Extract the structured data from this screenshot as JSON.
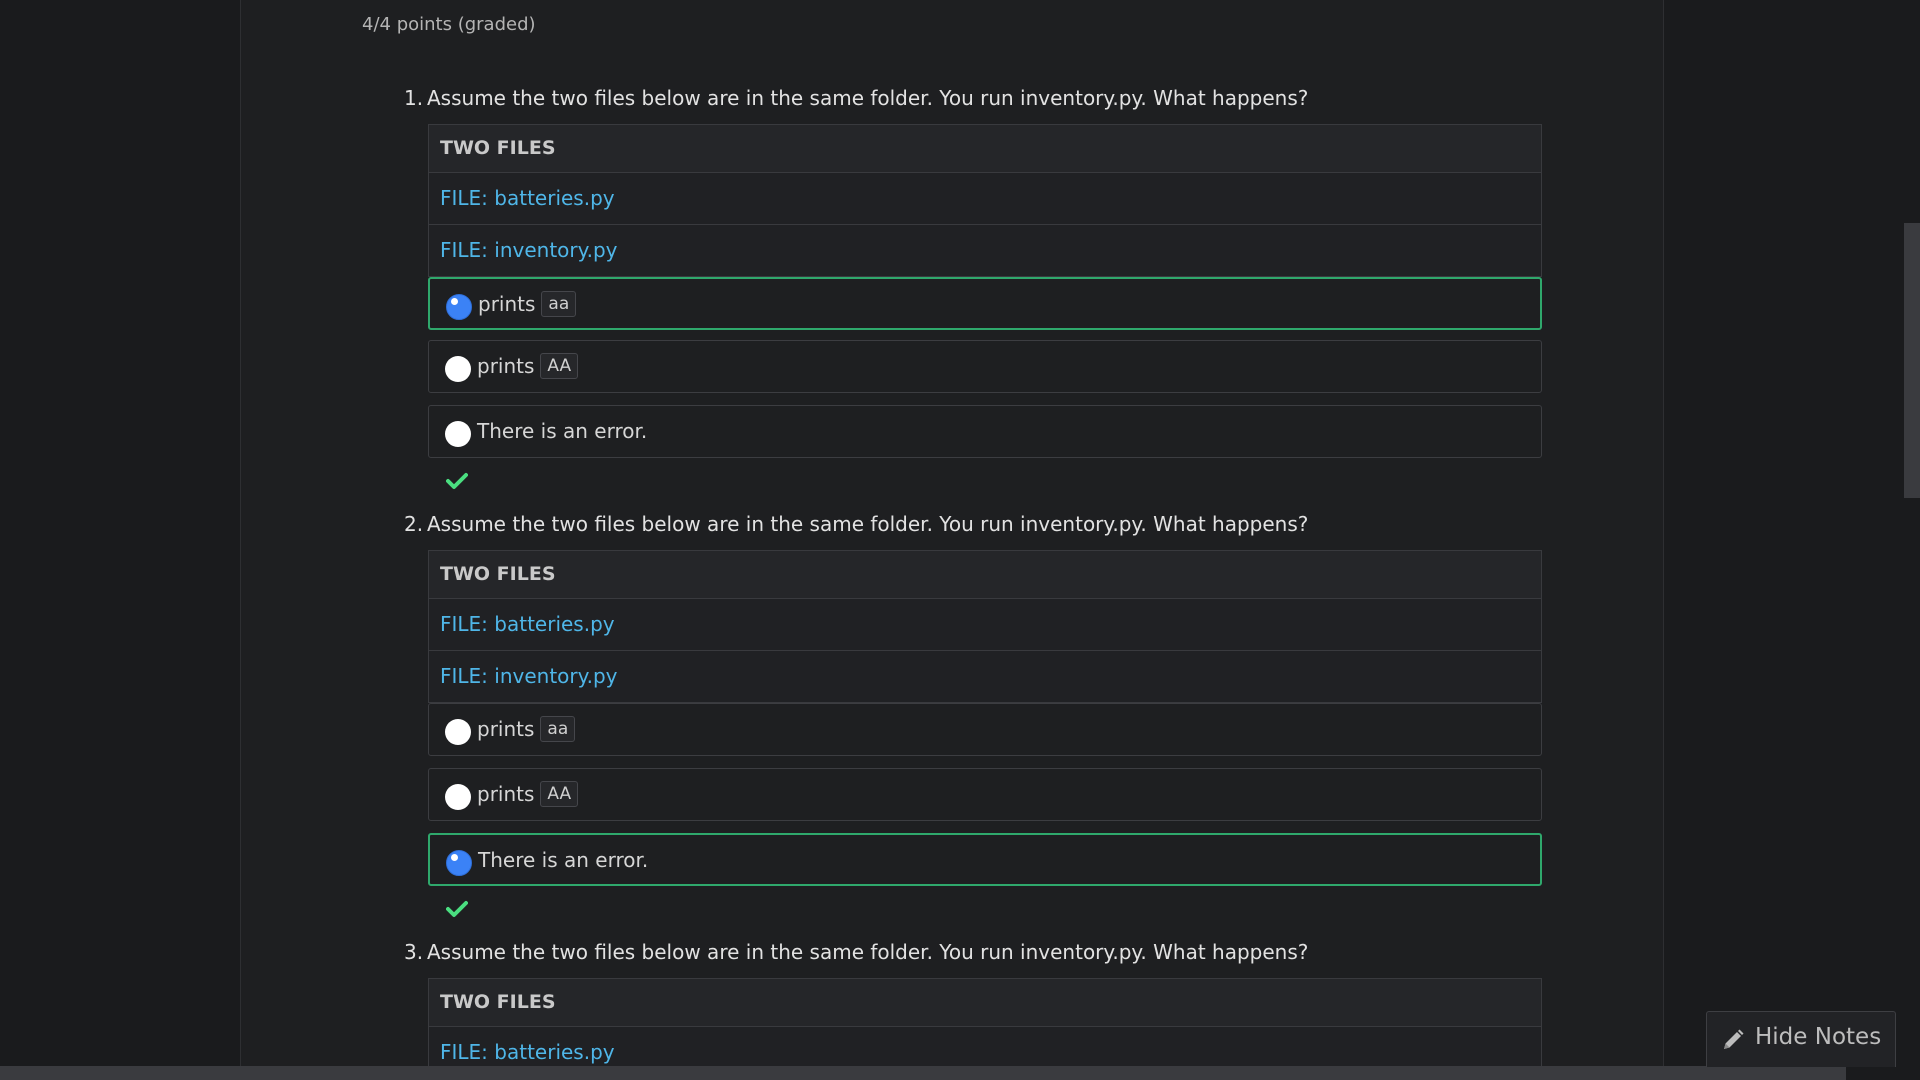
{
  "grade_status": "4/4 points (graded)",
  "questions": [
    {
      "number": "1.",
      "prompt": "Assume the two files below are in the same folder. You run inventory.py. What happens?",
      "files_header": "TWO FILES",
      "files": [
        "FILE: batteries.py",
        "FILE: inventory.py"
      ],
      "choices": [
        {
          "text": "prints",
          "code": "aa",
          "selected": true
        },
        {
          "text": "prints",
          "code": "AA",
          "selected": false
        },
        {
          "text": "There is an error.",
          "code": "",
          "selected": false
        }
      ]
    },
    {
      "number": "2.",
      "prompt": "Assume the two files below are in the same folder. You run inventory.py. What happens?",
      "files_header": "TWO FILES",
      "files": [
        "FILE: batteries.py",
        "FILE: inventory.py"
      ],
      "choices": [
        {
          "text": "prints",
          "code": "aa",
          "selected": false
        },
        {
          "text": "prints",
          "code": "AA",
          "selected": false
        },
        {
          "text": "There is an error.",
          "code": "",
          "selected": true
        }
      ]
    },
    {
      "number": "3.",
      "prompt": "Assume the two files below are in the same folder. You run inventory.py. What happens?",
      "files_header": "TWO FILES",
      "files": [
        "FILE: batteries.py"
      ]
    }
  ],
  "hide_notes_label": "Hide Notes",
  "colors": {
    "correct_border": "#2fa86c",
    "check_mark": "#4ade80",
    "link": "#4fb6e8",
    "radio_selected": "#3b82f6"
  },
  "icons": {
    "check": "check-icon",
    "pencil": "pencil-icon"
  }
}
